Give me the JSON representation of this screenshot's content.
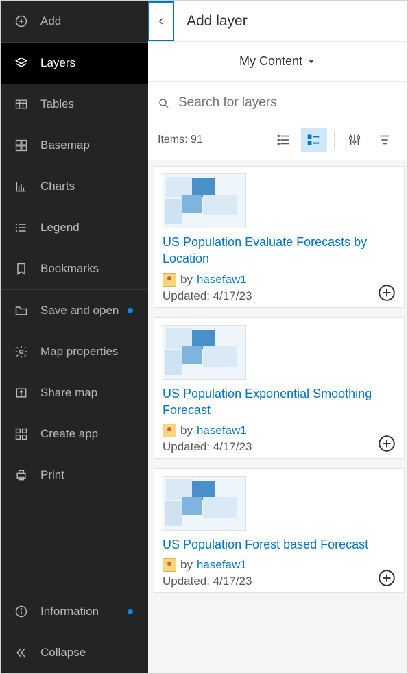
{
  "sidebar": {
    "items": [
      {
        "id": "add",
        "label": "Add"
      },
      {
        "id": "layers",
        "label": "Layers"
      },
      {
        "id": "tables",
        "label": "Tables"
      },
      {
        "id": "basemap",
        "label": "Basemap"
      },
      {
        "id": "charts",
        "label": "Charts"
      },
      {
        "id": "legend",
        "label": "Legend"
      },
      {
        "id": "bookmarks",
        "label": "Bookmarks"
      },
      {
        "id": "saveopen",
        "label": "Save and open"
      },
      {
        "id": "mapprops",
        "label": "Map properties"
      },
      {
        "id": "sharemap",
        "label": "Share map"
      },
      {
        "id": "createapp",
        "label": "Create app"
      },
      {
        "id": "print",
        "label": "Print"
      },
      {
        "id": "information",
        "label": "Information"
      },
      {
        "id": "collapse",
        "label": "Collapse"
      }
    ]
  },
  "panel": {
    "title": "Add layer",
    "scope": "My Content",
    "search_placeholder": "Search for layers",
    "items_count": "Items: 91",
    "by_label": "by",
    "results": [
      {
        "title": "US Population Evaluate Forecasts by Location",
        "author": "hasefaw1",
        "updated": "Updated: 4/17/23"
      },
      {
        "title": "US Population Exponential Smoothing Forecast",
        "author": "hasefaw1",
        "updated": "Updated: 4/17/23"
      },
      {
        "title": "US Population Forest based Forecast",
        "author": "hasefaw1",
        "updated": "Updated: 4/17/23"
      }
    ]
  }
}
